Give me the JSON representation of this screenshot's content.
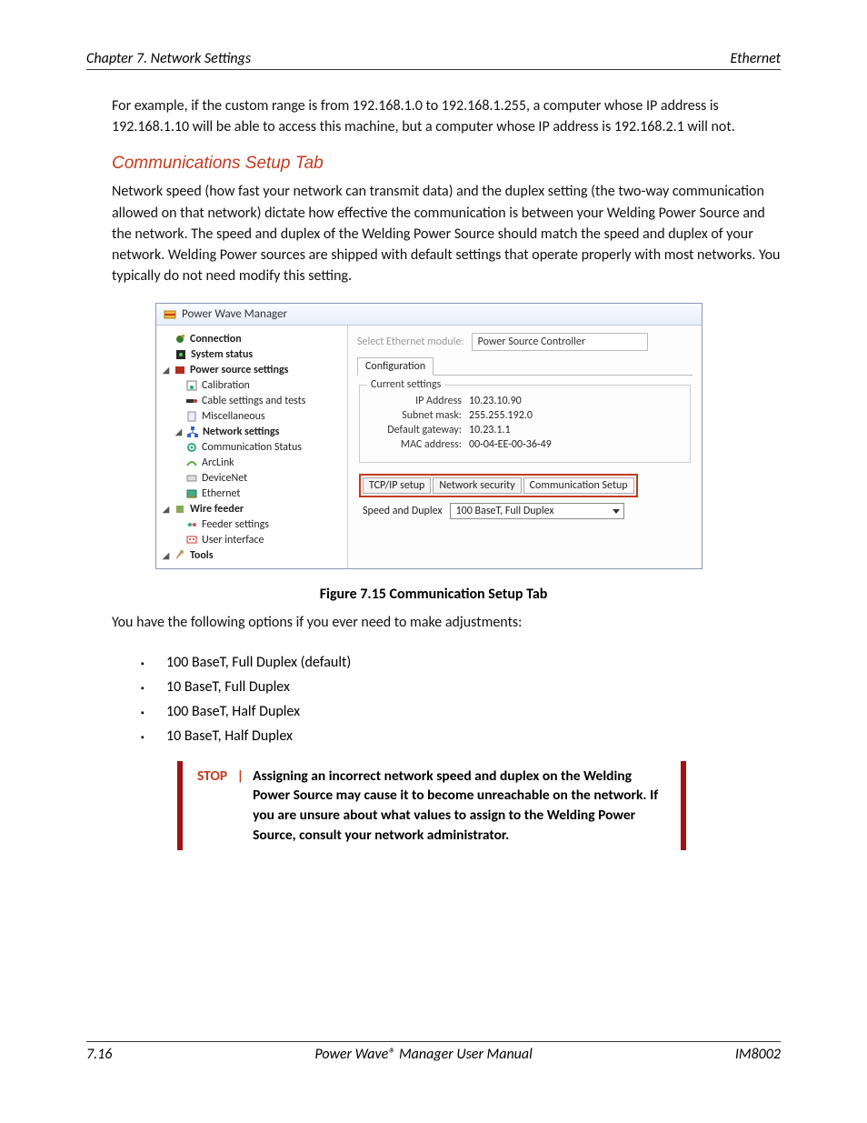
{
  "header": {
    "left": "Chapter 7. Network Settings",
    "right": "Ethernet"
  },
  "para_example": "For example, if the custom range is from 192.168.1.0 to 192.168.1.255, a computer whose IP address is 192.168.1.10 will be able to access this machine, but a computer whose IP address is 192.168.2.1 will not.",
  "section_heading": "Communications Setup Tab",
  "para_intro": "Network speed (how fast your network can transmit data) and the duplex setting (the two-way communication allowed on that network) dictate how effective the communication is between your Welding Power Source and the network.  The speed and duplex of the Welding Power Source should match the speed and duplex of your network.  Welding Power sources are shipped with default settings that operate properly with most networks.  You typically do not need modify this setting.",
  "app": {
    "title": "Power Wave Manager",
    "tree": {
      "connection": "Connection",
      "system_status": "System status",
      "power_source_settings": "Power source settings",
      "calibration": "Calibration",
      "cable_settings": "Cable settings and tests",
      "miscellaneous": "Miscellaneous",
      "network_settings": "Network settings",
      "communication_status": "Communication Status",
      "arclink": "ArcLink",
      "devicenet": "DeviceNet",
      "ethernet": "Ethernet",
      "wire_feeder": "Wire feeder",
      "feeder_settings": "Feeder settings",
      "user_interface": "User interface",
      "tools": "Tools"
    },
    "right": {
      "select_label": "Select Ethernet module:",
      "select_value": "Power Source Controller",
      "tab_config": "Configuration",
      "group_title": "Current settings",
      "ip_label": "IP Address",
      "ip_value": "10.23.10.90",
      "subnet_label": "Subnet mask:",
      "subnet_value": "255.255.192.0",
      "gateway_label": "Default gateway:",
      "gateway_value": "10.23.1.1",
      "mac_label": "MAC address:",
      "mac_value": "00-04-EE-00-36-49",
      "subtabs": {
        "tcpip": "TCP/IP setup",
        "security": "Network security",
        "comm": "Communication Setup"
      },
      "dropdown_label": "Speed and Duplex",
      "dropdown_value": "100 BaseT, Full Duplex"
    }
  },
  "figure_caption": "Figure 7.15   Communication Setup Tab",
  "options_intro": "You have the following options if you ever need to make adjustments:",
  "options": {
    "o1": "100 BaseT, Full Duplex (default)",
    "o2": "10 BaseT, Full Duplex",
    "o3": "100 BaseT, Half Duplex",
    "o4": "10 BaseT, Half Duplex"
  },
  "callout": {
    "stop": "STOP",
    "divider": "|",
    "text": "Assigning an incorrect network speed and duplex on the Welding Power Source may cause it to become unreachable on the network.  If you are unsure about what values to assign to the Welding Power Source, consult your network administrator."
  },
  "footer": {
    "left": "7.16",
    "center": "Power Wave® Manager User Manual",
    "right": "IM8002"
  }
}
